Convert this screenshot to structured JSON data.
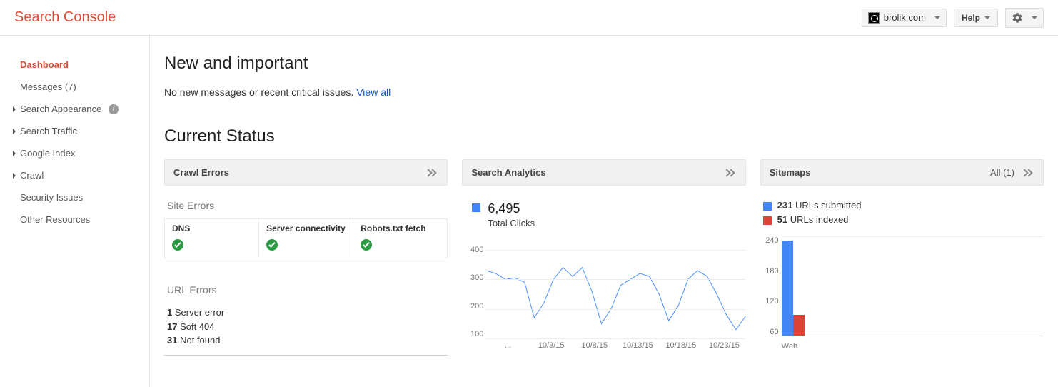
{
  "header": {
    "app_title": "Search Console",
    "property": "brolik.com",
    "help_label": "Help"
  },
  "sidebar": {
    "items": [
      {
        "label": "Dashboard",
        "active": true,
        "expandable": false
      },
      {
        "label": "Messages (7)",
        "active": false,
        "expandable": false
      },
      {
        "label": "Search Appearance",
        "active": false,
        "expandable": true,
        "info": true
      },
      {
        "label": "Search Traffic",
        "active": false,
        "expandable": true
      },
      {
        "label": "Google Index",
        "active": false,
        "expandable": true
      },
      {
        "label": "Crawl",
        "active": false,
        "expandable": true
      },
      {
        "label": "Security Issues",
        "active": false,
        "expandable": false
      },
      {
        "label": "Other Resources",
        "active": false,
        "expandable": false
      }
    ]
  },
  "main": {
    "new_heading": "New and important",
    "empty_msg": "No new messages or recent critical issues.",
    "view_all": "View all",
    "status_heading": "Current Status"
  },
  "crawl_card": {
    "title": "Crawl Errors",
    "site_errors_label": "Site Errors",
    "cells": {
      "dns": "DNS",
      "server": "Server connectivity",
      "robots": "Robots.txt fetch"
    },
    "url_errors_label": "URL Errors",
    "errors": [
      {
        "count": "1",
        "label": "Server error"
      },
      {
        "count": "17",
        "label": "Soft 404"
      },
      {
        "count": "31",
        "label": "Not found"
      }
    ]
  },
  "analytics_card": {
    "title": "Search Analytics",
    "clicks_value": "6,495",
    "clicks_label": "Total Clicks"
  },
  "sitemaps_card": {
    "title": "Sitemaps",
    "all_label": "All (1)",
    "submitted": {
      "count": "231",
      "label": "URLs submitted"
    },
    "indexed": {
      "count": "51",
      "label": "URLs indexed"
    },
    "x_label": "Web"
  },
  "chart_data": [
    {
      "type": "line",
      "title": "Search Analytics – Total Clicks",
      "ylabel": "Clicks",
      "ylim": [
        100,
        400
      ],
      "x": [
        "9/28/15",
        "9/29/15",
        "9/30/15",
        "10/1/15",
        "10/2/15",
        "10/3/15",
        "10/4/15",
        "10/5/15",
        "10/6/15",
        "10/7/15",
        "10/8/15",
        "10/9/15",
        "10/10/15",
        "10/11/15",
        "10/12/15",
        "10/13/15",
        "10/14/15",
        "10/15/15",
        "10/16/15",
        "10/17/15",
        "10/18/15",
        "10/19/15",
        "10/20/15",
        "10/21/15",
        "10/22/15",
        "10/23/15",
        "10/24/15",
        "10/25/15"
      ],
      "values": [
        330,
        320,
        300,
        305,
        290,
        170,
        220,
        300,
        340,
        310,
        340,
        260,
        150,
        200,
        280,
        300,
        320,
        310,
        250,
        160,
        210,
        300,
        330,
        310,
        250,
        180,
        130,
        175
      ],
      "x_ticks": [
        "...",
        "10/3/15",
        "10/8/15",
        "10/13/15",
        "10/18/15",
        "10/23/15"
      ],
      "y_ticks": [
        400,
        300,
        200,
        100
      ]
    },
    {
      "type": "bar",
      "title": "Sitemaps",
      "categories": [
        "Web"
      ],
      "series": [
        {
          "name": "URLs submitted",
          "color": "#4285f4",
          "values": [
            231
          ]
        },
        {
          "name": "URLs indexed",
          "color": "#db4437",
          "values": [
            51
          ]
        }
      ],
      "ylim": [
        0,
        240
      ],
      "y_ticks": [
        240,
        180,
        120,
        60
      ]
    }
  ]
}
